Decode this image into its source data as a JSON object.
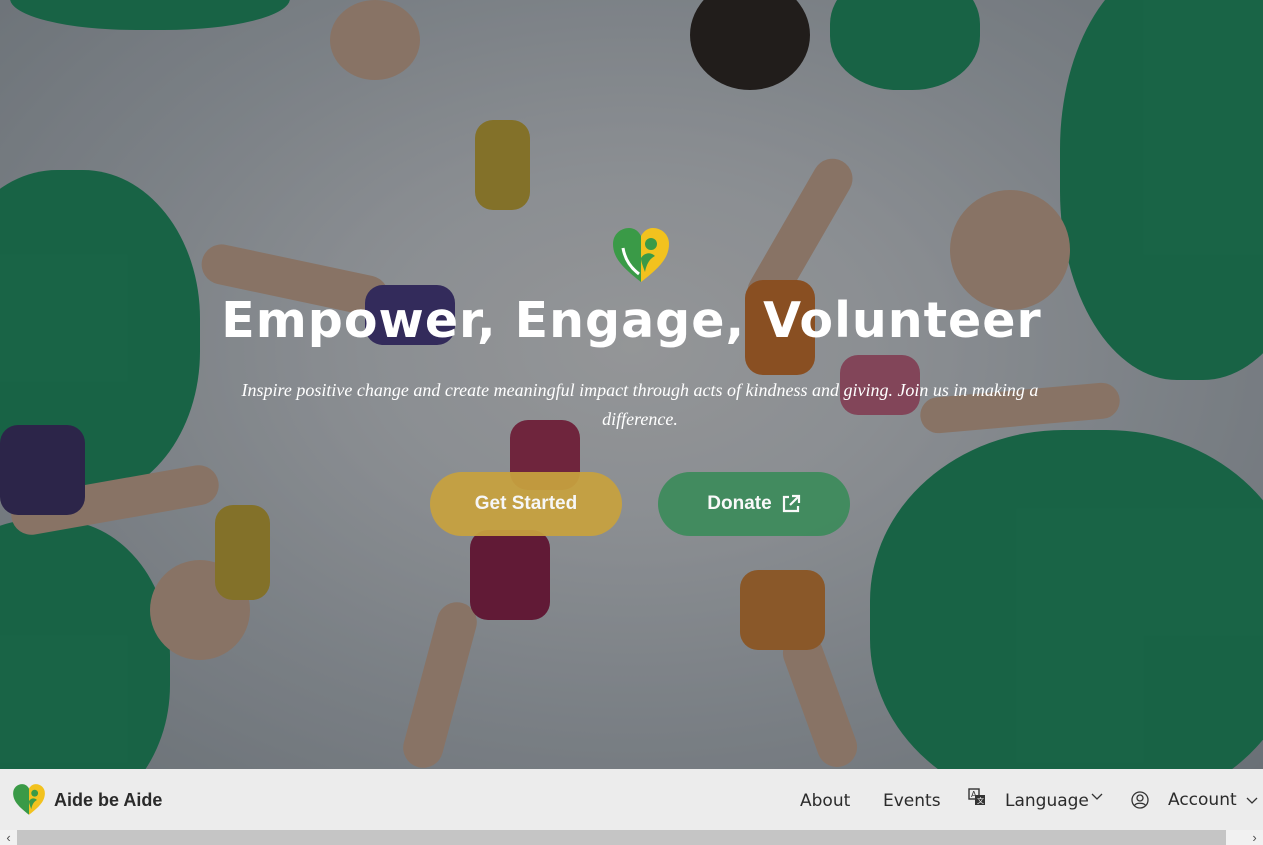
{
  "hero": {
    "title": "Empower, Engage, Volunteer",
    "subtitle": "Inspire positive change and create meaningful impact through acts of kindness and giving. Join us in making a difference.",
    "buttons": {
      "get_started": "Get Started",
      "donate": "Donate"
    }
  },
  "navbar": {
    "brand": "Aide be Aide",
    "items": {
      "about": "About",
      "events": "Events",
      "language": "Language",
      "account": "Account"
    }
  },
  "icons": {
    "logo": "heart-person-logo",
    "external": "external-link-icon",
    "translate": "translate-icon",
    "user": "user-circle-icon",
    "chevron": "chevron-down-icon"
  },
  "colors": {
    "accent_gold": "#c8a23f",
    "accent_green": "#3f8b5d",
    "navbar_bg": "#ececec"
  }
}
